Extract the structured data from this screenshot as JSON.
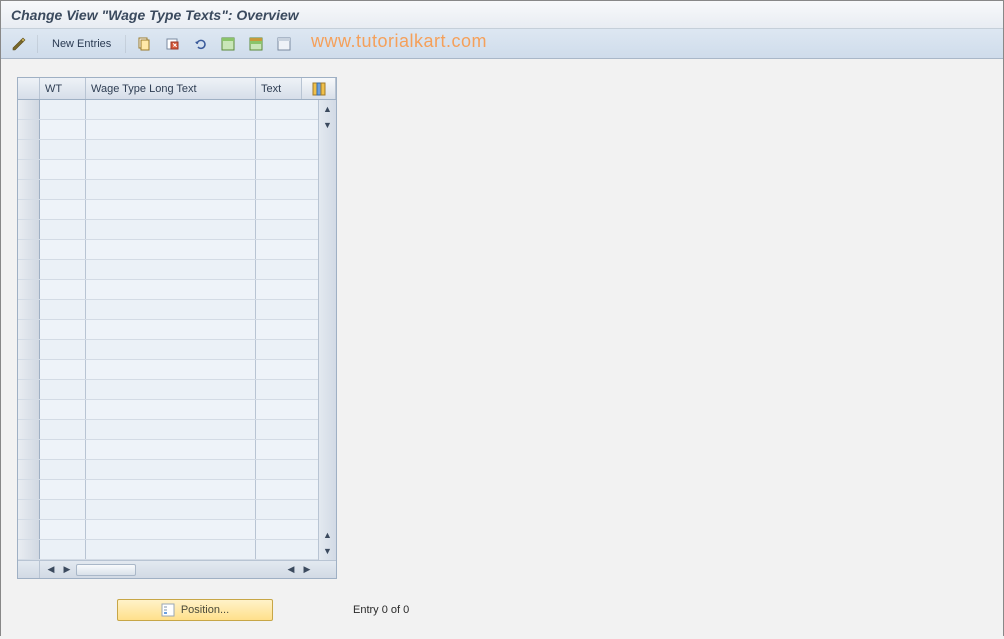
{
  "title": "Change View \"Wage Type Texts\": Overview",
  "toolbar": {
    "new_entries_label": "New Entries",
    "icons": {
      "toggle": "toggle",
      "copy": "copy",
      "delete": "delete",
      "undo": "undo",
      "select_all": "select_all",
      "select_block": "select_block",
      "deselect_all": "deselect_all"
    }
  },
  "watermark": "www.tutorialkart.com",
  "grid": {
    "columns": {
      "wt": "WT",
      "long": "Wage Type Long Text",
      "text": "Text"
    },
    "row_count": 23,
    "rows": []
  },
  "footer": {
    "position_label": "Position...",
    "entry_text": "Entry 0 of 0"
  }
}
